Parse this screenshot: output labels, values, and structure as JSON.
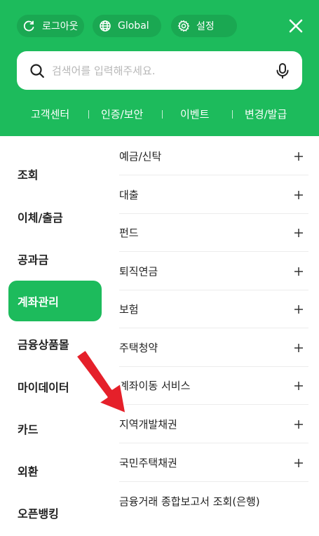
{
  "header": {
    "logout_label": "로그아웃",
    "global_label": "Global",
    "settings_label": "설정",
    "close_icon": "close-icon",
    "brand_color": "#1dbb5c"
  },
  "search": {
    "placeholder": "검색어를 입력해주세요.",
    "search_icon": "search-icon",
    "mic_icon": "microphone-icon"
  },
  "quick_links": [
    "고객센터",
    "인증/보안",
    "이벤트",
    "변경/발급"
  ],
  "categories": [
    {
      "label": "조회"
    },
    {
      "label": "이체/출금"
    },
    {
      "label": "공과금"
    },
    {
      "label": "계좌관리",
      "active": true
    },
    {
      "label": "금융상품몰"
    },
    {
      "label": "마이데이터"
    },
    {
      "label": "카드"
    },
    {
      "label": "외환"
    },
    {
      "label": "오픈뱅킹"
    }
  ],
  "submenu": [
    {
      "label": "예금/신탁",
      "expandable": true
    },
    {
      "label": "대출",
      "expandable": true
    },
    {
      "label": "펀드",
      "expandable": true
    },
    {
      "label": "퇴직연금",
      "expandable": true
    },
    {
      "label": "보험",
      "expandable": true
    },
    {
      "label": "주택청약",
      "expandable": true
    },
    {
      "label": "계좌이동 서비스",
      "expandable": true
    },
    {
      "label": "지역개발채권",
      "expandable": true
    },
    {
      "label": "국민주택채권",
      "expandable": true
    },
    {
      "label": "금융거래 종합보고서 조회(은행)",
      "expandable": false
    }
  ],
  "annotation": {
    "arrow_color": "#e5202a"
  }
}
